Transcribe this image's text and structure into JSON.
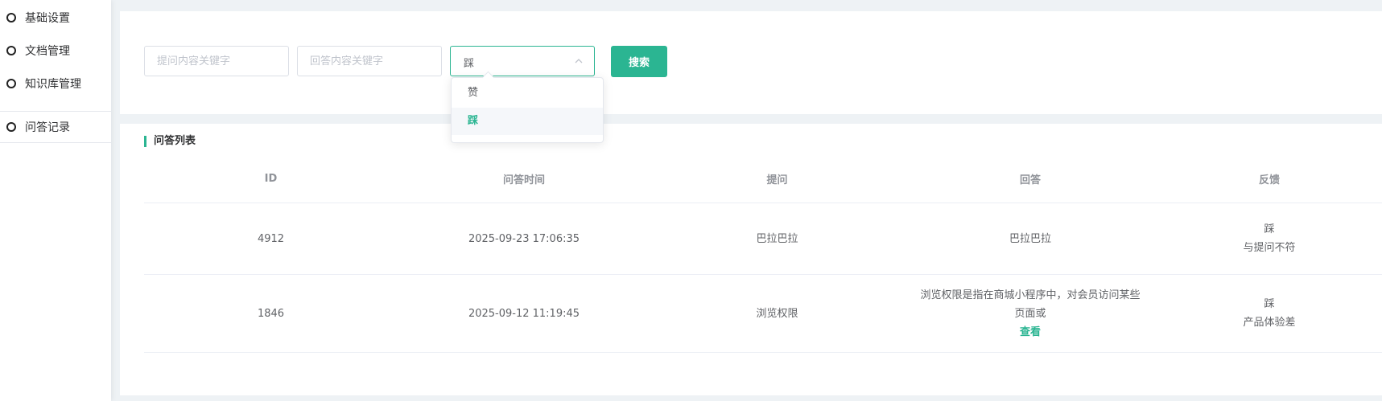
{
  "sidebar": {
    "items": [
      {
        "label": "基础设置",
        "active": false
      },
      {
        "label": "文档管理",
        "active": false
      },
      {
        "label": "知识库管理",
        "active": false
      },
      {
        "label": "问答记录",
        "active": true
      }
    ]
  },
  "search": {
    "question_placeholder": "提问内容关键字",
    "answer_placeholder": "回答内容关键字",
    "feedback_value": "踩",
    "button_label": "搜索",
    "dropdown_options": [
      "赞",
      "踩"
    ]
  },
  "table": {
    "title": "问答列表",
    "columns": [
      "ID",
      "问答时间",
      "提问",
      "回答",
      "反馈"
    ],
    "rows": [
      {
        "id": "4912",
        "time": "2025-09-23 17:06:35",
        "question": "巴拉巴拉",
        "answer_line1": "巴拉巴拉",
        "answer_line2": "",
        "view_label": "",
        "feedback": "踩",
        "feedback_reason": "与提问不符"
      },
      {
        "id": "1846",
        "time": "2025-09-12 11:19:45",
        "question": "浏览权限",
        "answer_line1": "浏览权限是指在商城小程序中，对会员访问某些",
        "answer_line2": "页面或",
        "view_label": "查看",
        "feedback": "踩",
        "feedback_reason": "产品体验差"
      }
    ]
  },
  "colors": {
    "accent": "#2bb592"
  }
}
